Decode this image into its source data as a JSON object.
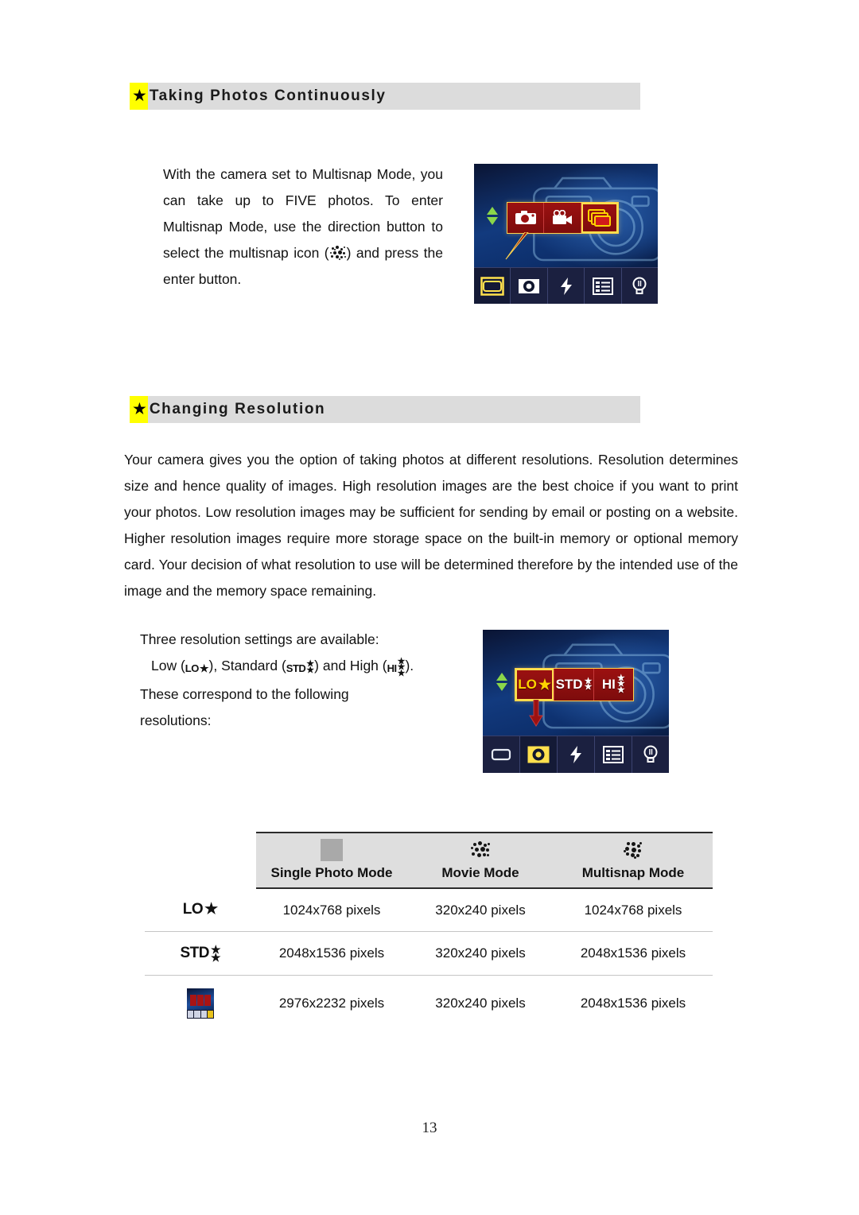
{
  "page": {
    "number": "13"
  },
  "sections": [
    {
      "star": "★",
      "title": "Taking Photos Continuously"
    },
    {
      "star": "★",
      "title": "Changing Resolution"
    }
  ],
  "multisnap": {
    "paragraph_before_icon": "With the camera set to Multisnap Mode, you can take up to FIVE photos. To enter Multisnap Mode, use the direction button to select the multisnap icon (",
    "paragraph_after_icon": ") and press the enter button.",
    "icon_name": "multisnap-speckle-icon"
  },
  "resolution": {
    "body": "Your camera gives you the option of taking photos at different resolutions. Resolution determines size and hence quality of images. High resolution images are the best choice if you want to print your photos. Low resolution images may be sufficient for sending by email or posting on a website. Higher resolution images require more storage space on the built-in memory or optional memory card. Your decision of what resolution to use will be determined therefore by the intended use of the image and the memory space remaining.",
    "intro": "Three resolution settings are available:",
    "settings_line_part1": "Low (",
    "settings_line_part2": "), Standard (",
    "settings_line_part3": ") and High (",
    "settings_line_part4": ").",
    "correspond_line1": "These correspond to the following",
    "correspond_line2": "resolutions:",
    "labels": {
      "low": "LO",
      "standard": "STD",
      "high": "HI",
      "star": "★"
    }
  },
  "lcd_mode_menu": {
    "caption": "camera-mode-menu-screen",
    "menu_items": [
      {
        "name": "single-photo-mode",
        "icon": "camera-icon",
        "selected": false
      },
      {
        "name": "movie-mode",
        "icon": "movie-camera-icon",
        "selected": false
      },
      {
        "name": "multisnap-mode",
        "icon": "stacked-photos-icon",
        "selected": true
      }
    ],
    "bottom_items": [
      {
        "name": "mode-frame",
        "icon": "frame-icon",
        "highlighted": true
      },
      {
        "name": "resolution",
        "icon": "aperture-icon",
        "highlighted": false
      },
      {
        "name": "flash",
        "icon": "lightning-bolt-icon",
        "highlighted": false
      },
      {
        "name": "menu",
        "icon": "list-icon",
        "highlighted": false
      },
      {
        "name": "lamp",
        "icon": "light-bulb-icon",
        "highlighted": false
      }
    ]
  },
  "lcd_resolution_menu": {
    "caption": "resolution-menu-screen",
    "menu_items": [
      {
        "name": "low-resolution",
        "label": "LO",
        "stars": 1,
        "selected": true
      },
      {
        "name": "standard-resolution",
        "label": "STD",
        "stars": 2,
        "selected": false
      },
      {
        "name": "high-resolution",
        "label": "HI",
        "stars": 3,
        "selected": false
      }
    ],
    "bottom_items": [
      {
        "name": "mode-frame",
        "icon": "frame-icon",
        "highlighted": false
      },
      {
        "name": "resolution",
        "icon": "aperture-icon",
        "highlighted": true
      },
      {
        "name": "flash",
        "icon": "lightning-bolt-icon",
        "highlighted": false
      },
      {
        "name": "menu",
        "icon": "list-icon",
        "highlighted": false
      },
      {
        "name": "lamp",
        "icon": "light-bulb-icon",
        "highlighted": false
      }
    ]
  },
  "table": {
    "headers": [
      {
        "icon": "gray-square-icon",
        "label": "Single Photo Mode"
      },
      {
        "icon": "movie-speckle-icon",
        "label": "Movie Mode"
      },
      {
        "icon": "multisnap-speckle-icon",
        "label": "Multisnap Mode"
      }
    ],
    "rows": [
      {
        "setting_icon": "low-resolution-icon",
        "setting_label": "LO",
        "setting_stars": 1,
        "single_photo": "1024x768 pixels",
        "movie": "320x240 pixels",
        "multisnap": "1024x768 pixels"
      },
      {
        "setting_icon": "standard-resolution-icon",
        "setting_label": "STD",
        "setting_stars": 2,
        "single_photo": "2048x1536 pixels",
        "movie": "320x240 pixels",
        "multisnap": "2048x1536 pixels"
      },
      {
        "setting_icon": "high-resolution-lcd-thumbnail-icon",
        "setting_label": "",
        "setting_stars": 0,
        "single_photo": "2976x2232 pixels",
        "movie": "320x240 pixels",
        "multisnap": "2048x1536 pixels"
      }
    ]
  },
  "colors": {
    "section_bar": "#dcdcdc",
    "star_highlight": "#ffff00",
    "table_header_bg": "#dedede",
    "lcd_menu_red": "#9c1111",
    "lcd_select_gold": "#ffd400"
  }
}
